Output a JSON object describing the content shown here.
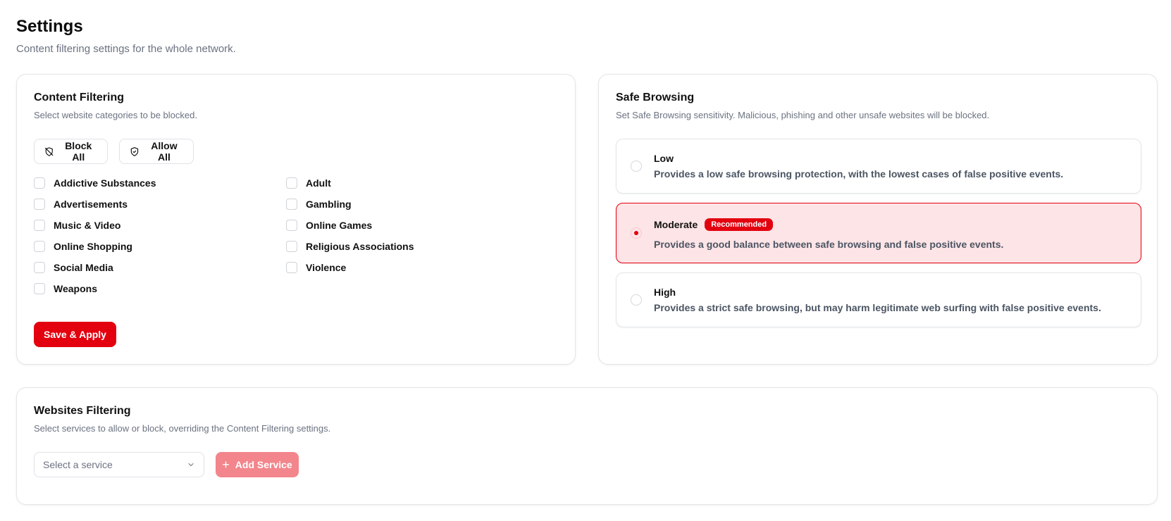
{
  "page": {
    "title": "Settings",
    "subtitle": "Content filtering settings for the whole network."
  },
  "content_filtering": {
    "title": "Content Filtering",
    "description": "Select website categories to be blocked.",
    "block_all_label": "Block All",
    "allow_all_label": "Allow All",
    "categories_left": [
      "Addictive Substances",
      "Advertisements",
      "Music & Video",
      "Online Shopping",
      "Social Media",
      "Weapons"
    ],
    "categories_right": [
      "Adult",
      "Gambling",
      "Online Games",
      "Religious Associations",
      "Violence"
    ],
    "save_label": "Save & Apply"
  },
  "safe_browsing": {
    "title": "Safe Browsing",
    "description": "Set Safe Browsing sensitivity. Malicious, phishing and other unsafe websites will be blocked.",
    "selected": "Moderate",
    "options": [
      {
        "title": "Low",
        "description": "Provides a low safe browsing protection, with the lowest cases of false positive events."
      },
      {
        "title": "Moderate",
        "badge": "Recommended",
        "description": "Provides a good balance between safe browsing and false positive events."
      },
      {
        "title": "High",
        "description": "Provides a strict safe browsing, but may harm legitimate web surfing with false positive events."
      }
    ]
  },
  "websites_filtering": {
    "title": "Websites Filtering",
    "description": "Select services to allow or block, overriding the Content Filtering settings.",
    "select_placeholder": "Select a service",
    "add_label": "Add Service"
  },
  "colors": {
    "accent": "#e3000f",
    "accent_light": "#fde4e6",
    "accent_disabled": "#f2868c"
  },
  "icons": {
    "block_all": "shield-off-icon",
    "allow_all": "shield-check-icon",
    "select": "chevron-down-icon",
    "add": "plus-icon"
  }
}
